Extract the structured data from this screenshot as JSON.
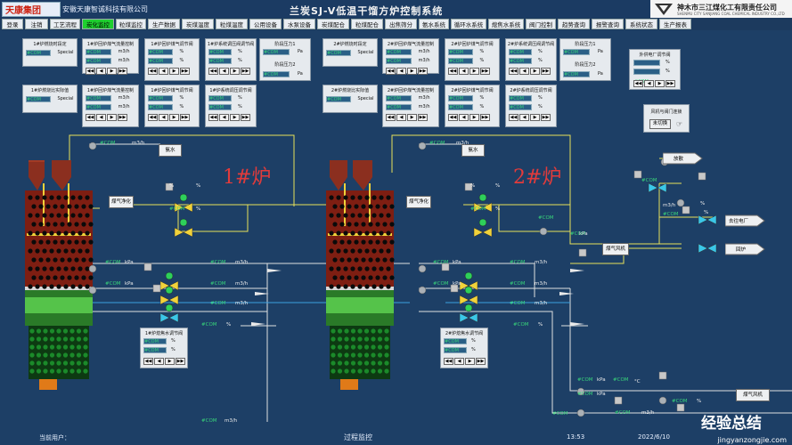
{
  "header": {
    "logo_text": "天康集团",
    "company": "安徽天康智诚科技有限公司",
    "title": "兰炭SJ-V低温干馏方炉控制系统",
    "corp_name": "神木市三江煤化工有限责任公司",
    "corp_sub": "SHENMU CITY SANJIANG COAL CHEMICAL INDUSTRY CO.,LTD"
  },
  "nav": [
    {
      "label": "登录",
      "active": false
    },
    {
      "label": "注销",
      "active": false
    },
    {
      "label": "工艺流程",
      "active": false
    },
    {
      "label": "炭化监控",
      "active": true
    },
    {
      "label": "粒煤监控",
      "active": false
    },
    {
      "label": "生产数据",
      "active": false
    },
    {
      "label": "炭煤温度",
      "active": false
    },
    {
      "label": "粒煤温度",
      "active": false
    },
    {
      "label": "公用设备",
      "active": false
    },
    {
      "label": "水泵设备",
      "active": false
    },
    {
      "label": "炭煤配仓",
      "active": false
    },
    {
      "label": "粒煤配仓",
      "active": false
    },
    {
      "label": "出焦筛分",
      "active": false
    },
    {
      "label": "氨水系统",
      "active": false
    },
    {
      "label": "循环水系统",
      "active": false
    },
    {
      "label": "熄焦水系统",
      "active": false
    },
    {
      "label": "阀门控制",
      "active": false
    },
    {
      "label": "趋势查询",
      "active": false
    },
    {
      "label": "报警查询",
      "active": false
    },
    {
      "label": "系统状态",
      "active": false
    },
    {
      "label": "生产报表",
      "active": false
    }
  ],
  "com": "#COM",
  "units": {
    "m3h": "m3/h",
    "pct": "%",
    "pa": "Pa",
    "kpa": "kPa",
    "c": "°C"
  },
  "special": "Special",
  "controls": [
    "◀◀",
    "◀",
    "▶",
    "▶▶"
  ],
  "furnace1": {
    "label": "1#炉",
    "p1": {
      "title": "1#炉燃烧时段定"
    },
    "p2": {
      "title": "1#炉回炉煤气流量控制"
    },
    "p3": {
      "title": "1#炉回炉煤气调节阀"
    },
    "p4": {
      "title": "1#炉系统调压阀调节阀"
    },
    "pr1": "阶段压力1",
    "pr2": "阶段压力2",
    "p5": {
      "title": "1#炉燃烧比实际值"
    },
    "p6": {
      "title": "1#炉回炉煤气流量控制"
    },
    "p7": {
      "title": "1#炉回炉煤气调节阀"
    },
    "p8": {
      "title": "1#炉系统调压调节阀"
    },
    "ammonia": "氨水",
    "purify": "煤气净化",
    "steam": "1#炉熄焦水调节阀"
  },
  "furnace2": {
    "label": "2#炉",
    "p1": {
      "title": "2#炉燃烧时段定"
    },
    "p2": {
      "title": "2#炉回炉煤气流量控制"
    },
    "p3": {
      "title": "2#炉回炉煤气调节阀"
    },
    "p4": {
      "title": "2#炉系统调压阀调节阀"
    },
    "pr1": "阶段压力1",
    "pr2": "阶段压力2",
    "p5": {
      "title": "2#炉燃烧比实际值"
    },
    "p6": {
      "title": "2#炉回炉煤气流量控制"
    },
    "p7": {
      "title": "2#炉回炉煤气调节阀"
    },
    "p8": {
      "title": "2#炉系统调压调节阀"
    },
    "ammonia": "氨水",
    "purify": "煤气净化",
    "steam": "2#炉熄焦水调节阀"
  },
  "right": {
    "export_valve": "外供电厂调节阀",
    "fan_valve": "风机与阀门连锁",
    "fan_valve_btn": "未切换",
    "torch": "放散",
    "plant": "去往电厂",
    "return": "回炉",
    "fan": "煤气风机",
    "fan2": "煤气风机"
  },
  "footer": {
    "user_label": "当前用户：",
    "screen": "过程监控",
    "time": "13:53",
    "date": "2022/6/10"
  },
  "watermark": {
    "main": "经验总结",
    "sub": "jingyanzongjie.com"
  }
}
